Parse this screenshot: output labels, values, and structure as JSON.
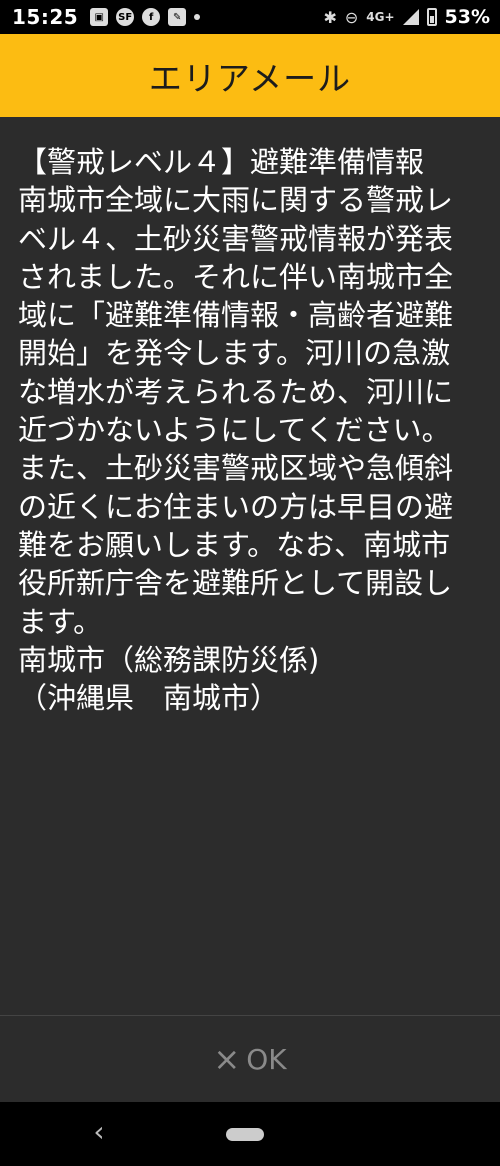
{
  "status_bar": {
    "time": "15:25",
    "notification_icons": [
      "image-icon",
      "sf-app-icon",
      "facebook-icon",
      "news-app-icon",
      "dot-icon"
    ],
    "network": "4G+",
    "battery": "53%"
  },
  "header": {
    "title": "エリアメール"
  },
  "message": {
    "body": "【警戒レベル４】避難準備情報\n南城市全域に大雨に関する警戒レベル４、土砂災害警戒情報が発表されました。それに伴い南城市全域に「避難準備情報・高齢者避難開始」を発令します。河川の急激な増水が考えられるため、河川に近づかないようにしてください。また、土砂災害警戒区域や急傾斜の近くにお住まいの方は早目の避難をお願いします。なお、南城市役所新庁舎を避難所として開設します。\n南城市（総務課防災係)\n（沖縄県　南城市）"
  },
  "footer": {
    "ok_icon": "×",
    "ok_label": "OK"
  },
  "nav": {
    "back_icon": "‹"
  },
  "colors": {
    "header_bg": "#fcbc12",
    "body_bg": "#2c2c2c",
    "text": "#ffffff",
    "button_text": "#8a8a8a"
  }
}
